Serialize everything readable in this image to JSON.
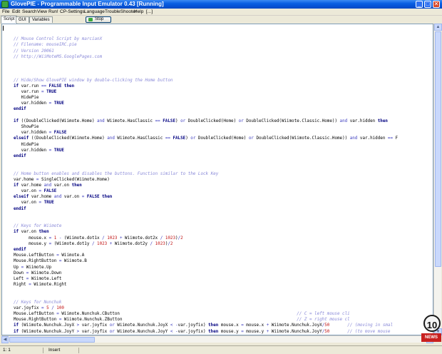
{
  "window": {
    "title": "GlovePIE - Programmable Input Emulator 0.43 [Running]",
    "controls": {
      "minimize": "_",
      "maximize": "□",
      "close": "✕"
    },
    "icon": "glove-app-icon"
  },
  "menu": [
    "File",
    "Edit",
    "Search",
    "View",
    "Run!",
    "CP-Settings",
    "Language",
    "TroubleShooter",
    "Help",
    "[...]"
  ],
  "tabs": [
    "Script",
    "GUI",
    "Variables"
  ],
  "run_button": {
    "label": "Stop",
    "icon": "run-icon"
  },
  "code_lines": [
    [],
    [
      [
        "cm",
        "// Mouse Control Script by marcianX"
      ]
    ],
    [
      [
        "cm",
        "// Filename: mouseIRC.pie"
      ]
    ],
    [
      [
        "cm",
        "// Version 20061"
      ]
    ],
    [
      [
        "cm",
        "// http://WiiMoteMS.GooglePages.com"
      ]
    ],
    [],
    [],
    [],
    [
      [
        "cm",
        "// Hide/Show GlovePIE window by double-clicking the Home button"
      ]
    ],
    [
      [
        "kw",
        "if"
      ],
      [
        "t",
        " var.run "
      ],
      [
        "op",
        "=="
      ],
      [
        "t",
        " "
      ],
      [
        "kw",
        "FALSE"
      ],
      [
        "t",
        " "
      ],
      [
        "kw",
        "then"
      ]
    ],
    [
      [
        "t",
        "   var.run "
      ],
      [
        "op",
        "="
      ],
      [
        "t",
        " "
      ],
      [
        "kw",
        "TRUE"
      ]
    ],
    [
      [
        "t",
        "   HidePie"
      ]
    ],
    [
      [
        "t",
        "   var.hidden "
      ],
      [
        "op",
        "="
      ],
      [
        "t",
        " "
      ],
      [
        "kw",
        "TRUE"
      ]
    ],
    [
      [
        "kw",
        "endif"
      ]
    ],
    [],
    [
      [
        "kw",
        "if"
      ],
      [
        "t",
        " ((DoubleClicked(Wiimote.Home) "
      ],
      [
        "op",
        "and"
      ],
      [
        "t",
        " Wiimote.HasClassic "
      ],
      [
        "op",
        "=="
      ],
      [
        "t",
        " "
      ],
      [
        "kw",
        "FALSE"
      ],
      [
        "t",
        ") "
      ],
      [
        "op",
        "or"
      ],
      [
        "t",
        " DoubleClicked(Home) "
      ],
      [
        "op",
        "or"
      ],
      [
        "t",
        " DoubleClicked(Wiimote.Classic.Home)) "
      ],
      [
        "op",
        "and"
      ],
      [
        "t",
        " var.hidden "
      ],
      [
        "kw",
        "then"
      ]
    ],
    [
      [
        "t",
        "   ShowPie"
      ]
    ],
    [
      [
        "t",
        "   var.hidden "
      ],
      [
        "op",
        "="
      ],
      [
        "t",
        " "
      ],
      [
        "kw",
        "FALSE"
      ]
    ],
    [
      [
        "kw",
        "elseif"
      ],
      [
        "t",
        " ((DoubleClicked(Wiimote.Home) "
      ],
      [
        "op",
        "and"
      ],
      [
        "t",
        " Wiimote.HasClassic "
      ],
      [
        "op",
        "=="
      ],
      [
        "t",
        " "
      ],
      [
        "kw",
        "FALSE"
      ],
      [
        "t",
        ") "
      ],
      [
        "op",
        "or"
      ],
      [
        "t",
        " DoubleClicked(Home) "
      ],
      [
        "op",
        "or"
      ],
      [
        "t",
        " DoubleClicked(Wiimote.Classic.Home)) "
      ],
      [
        "op",
        "and"
      ],
      [
        "t",
        " var.hidden "
      ],
      [
        "op",
        "=="
      ],
      [
        "t",
        " F"
      ]
    ],
    [
      [
        "t",
        "   HidePie"
      ]
    ],
    [
      [
        "t",
        "   var.hidden "
      ],
      [
        "op",
        "="
      ],
      [
        "t",
        " "
      ],
      [
        "kw",
        "TRUE"
      ]
    ],
    [
      [
        "kw",
        "endif"
      ]
    ],
    [],
    [],
    [
      [
        "cm",
        "// Home button enables and disables the buttons. Function similar to the Lock Key"
      ]
    ],
    [
      [
        "t",
        "var.home "
      ],
      [
        "op",
        "="
      ],
      [
        "t",
        " SingleClicked(Wiimote.Home)"
      ]
    ],
    [
      [
        "kw",
        "if"
      ],
      [
        "t",
        " var.home "
      ],
      [
        "op",
        "and"
      ],
      [
        "t",
        " var.on "
      ],
      [
        "kw",
        "then"
      ]
    ],
    [
      [
        "t",
        "   var.on "
      ],
      [
        "op",
        "="
      ],
      [
        "t",
        " "
      ],
      [
        "kw",
        "FALSE"
      ]
    ],
    [
      [
        "kw",
        "elseif"
      ],
      [
        "t",
        " var.home "
      ],
      [
        "op",
        "and"
      ],
      [
        "t",
        " var.on "
      ],
      [
        "op",
        "="
      ],
      [
        "t",
        " "
      ],
      [
        "kw",
        "FALSE"
      ],
      [
        "t",
        " "
      ],
      [
        "kw",
        "then"
      ]
    ],
    [
      [
        "t",
        "   var.on "
      ],
      [
        "op",
        "="
      ],
      [
        "t",
        " "
      ],
      [
        "kw",
        "TRUE"
      ]
    ],
    [
      [
        "kw",
        "endif"
      ]
    ],
    [],
    [],
    [
      [
        "cm",
        "// Keys for Wiimote"
      ]
    ],
    [
      [
        "kw",
        "if"
      ],
      [
        "t",
        " var.on "
      ],
      [
        "kw",
        "then"
      ]
    ],
    [
      [
        "t",
        "      mouse.x "
      ],
      [
        "op",
        "="
      ],
      [
        "t",
        " "
      ],
      [
        "num",
        "1"
      ],
      [
        "t",
        " "
      ],
      [
        "op",
        "-"
      ],
      [
        "t",
        " (Wiimote.dot1x "
      ],
      [
        "op",
        "/"
      ],
      [
        "t",
        " "
      ],
      [
        "num",
        "1023"
      ],
      [
        "t",
        " "
      ],
      [
        "op",
        "+"
      ],
      [
        "t",
        " Wiimote.dot2x "
      ],
      [
        "op",
        "/"
      ],
      [
        "t",
        " "
      ],
      [
        "num",
        "1023"
      ],
      [
        "t",
        ")"
      ],
      [
        "op",
        "/"
      ],
      [
        "num",
        "2"
      ]
    ],
    [
      [
        "t",
        "      mouse.y "
      ],
      [
        "op",
        "="
      ],
      [
        "t",
        " (Wiimote.dot1y "
      ],
      [
        "op",
        "/"
      ],
      [
        "t",
        " "
      ],
      [
        "num",
        "1023"
      ],
      [
        "t",
        " "
      ],
      [
        "op",
        "+"
      ],
      [
        "t",
        " Wiimote.dot2y "
      ],
      [
        "op",
        "/"
      ],
      [
        "t",
        " "
      ],
      [
        "num",
        "1023"
      ],
      [
        "t",
        ")"
      ],
      [
        "op",
        "/"
      ],
      [
        "num",
        "2"
      ]
    ],
    [
      [
        "kw",
        "endif"
      ]
    ],
    [
      [
        "t",
        "Mouse.LeftButton "
      ],
      [
        "op",
        "="
      ],
      [
        "t",
        " Wiimote.A"
      ]
    ],
    [
      [
        "t",
        "Mouse.RightButton "
      ],
      [
        "op",
        "="
      ],
      [
        "t",
        " Wiimote.B"
      ]
    ],
    [
      [
        "t",
        "Up "
      ],
      [
        "op",
        "="
      ],
      [
        "t",
        " Wiimote.Up"
      ]
    ],
    [
      [
        "t",
        "Down "
      ],
      [
        "op",
        "="
      ],
      [
        "t",
        " Wiimote.Down"
      ]
    ],
    [
      [
        "t",
        "Left "
      ],
      [
        "op",
        "="
      ],
      [
        "t",
        " Wiimote.Left"
      ]
    ],
    [
      [
        "t",
        "Right "
      ],
      [
        "op",
        "="
      ],
      [
        "t",
        " Wiimote.Right"
      ]
    ],
    [],
    [],
    [
      [
        "cm",
        "// Keys for Nunchuk"
      ]
    ],
    [
      [
        "t",
        "var.joyfix "
      ],
      [
        "op",
        "="
      ],
      [
        "t",
        " "
      ],
      [
        "num",
        "5"
      ],
      [
        "t",
        " "
      ],
      [
        "op",
        "/"
      ],
      [
        "t",
        " "
      ],
      [
        "num",
        "100"
      ]
    ],
    [
      [
        "t",
        "Mouse.LeftButton "
      ],
      [
        "op",
        "="
      ],
      [
        "t",
        " Wiimote.Nunchuk.CButton                                                                      "
      ],
      [
        "cm",
        "// C = left mouse cli"
      ]
    ],
    [
      [
        "t",
        "Mouse.RightButton "
      ],
      [
        "op",
        "="
      ],
      [
        "t",
        " Wiimote.Nunchuk.ZButton                                                                     "
      ],
      [
        "cm",
        "// Z = right mouse cl"
      ]
    ],
    [
      [
        "kw",
        "if"
      ],
      [
        "t",
        " (Wiimote.Nunchuk.JoyX "
      ],
      [
        "op",
        ">"
      ],
      [
        "t",
        " var.joyfix "
      ],
      [
        "op",
        "or"
      ],
      [
        "t",
        " Wiimote.Nunchuk.JoyX "
      ],
      [
        "op",
        "<"
      ],
      [
        "t",
        " "
      ],
      [
        "op",
        "-"
      ],
      [
        "t",
        "var.joyfix) "
      ],
      [
        "kw",
        "then"
      ],
      [
        "t",
        " mouse.x "
      ],
      [
        "op",
        "="
      ],
      [
        "t",
        " mouse.x "
      ],
      [
        "op",
        "+"
      ],
      [
        "t",
        " Wiimote.Nunchuk.JoyX"
      ],
      [
        "op",
        "/"
      ],
      [
        "num",
        "50"
      ],
      [
        "t",
        "       "
      ],
      [
        "cm",
        "// (moving in smal"
      ]
    ],
    [
      [
        "kw",
        "if"
      ],
      [
        "t",
        " (Wiimote.Nunchuk.JoyY "
      ],
      [
        "op",
        ">"
      ],
      [
        "t",
        " var.joyfix "
      ],
      [
        "op",
        "or"
      ],
      [
        "t",
        " Wiimote.Nunchuk.JoyY "
      ],
      [
        "op",
        "<"
      ],
      [
        "t",
        " "
      ],
      [
        "op",
        "-"
      ],
      [
        "t",
        "var.joyfix) "
      ],
      [
        "kw",
        "then"
      ],
      [
        "t",
        " mouse.y "
      ],
      [
        "op",
        "="
      ],
      [
        "t",
        " mouse.y "
      ],
      [
        "op",
        "+"
      ],
      [
        "t",
        " Wiimote.Nunchuk.JoyY"
      ],
      [
        "op",
        "/"
      ],
      [
        "num",
        "50"
      ],
      [
        "t",
        "       "
      ],
      [
        "cm",
        "// (to move mouse "
      ]
    ]
  ],
  "status": {
    "position": "1:  1",
    "mode": "Insert"
  },
  "badge": {
    "number": "10",
    "text": "NEWS"
  }
}
